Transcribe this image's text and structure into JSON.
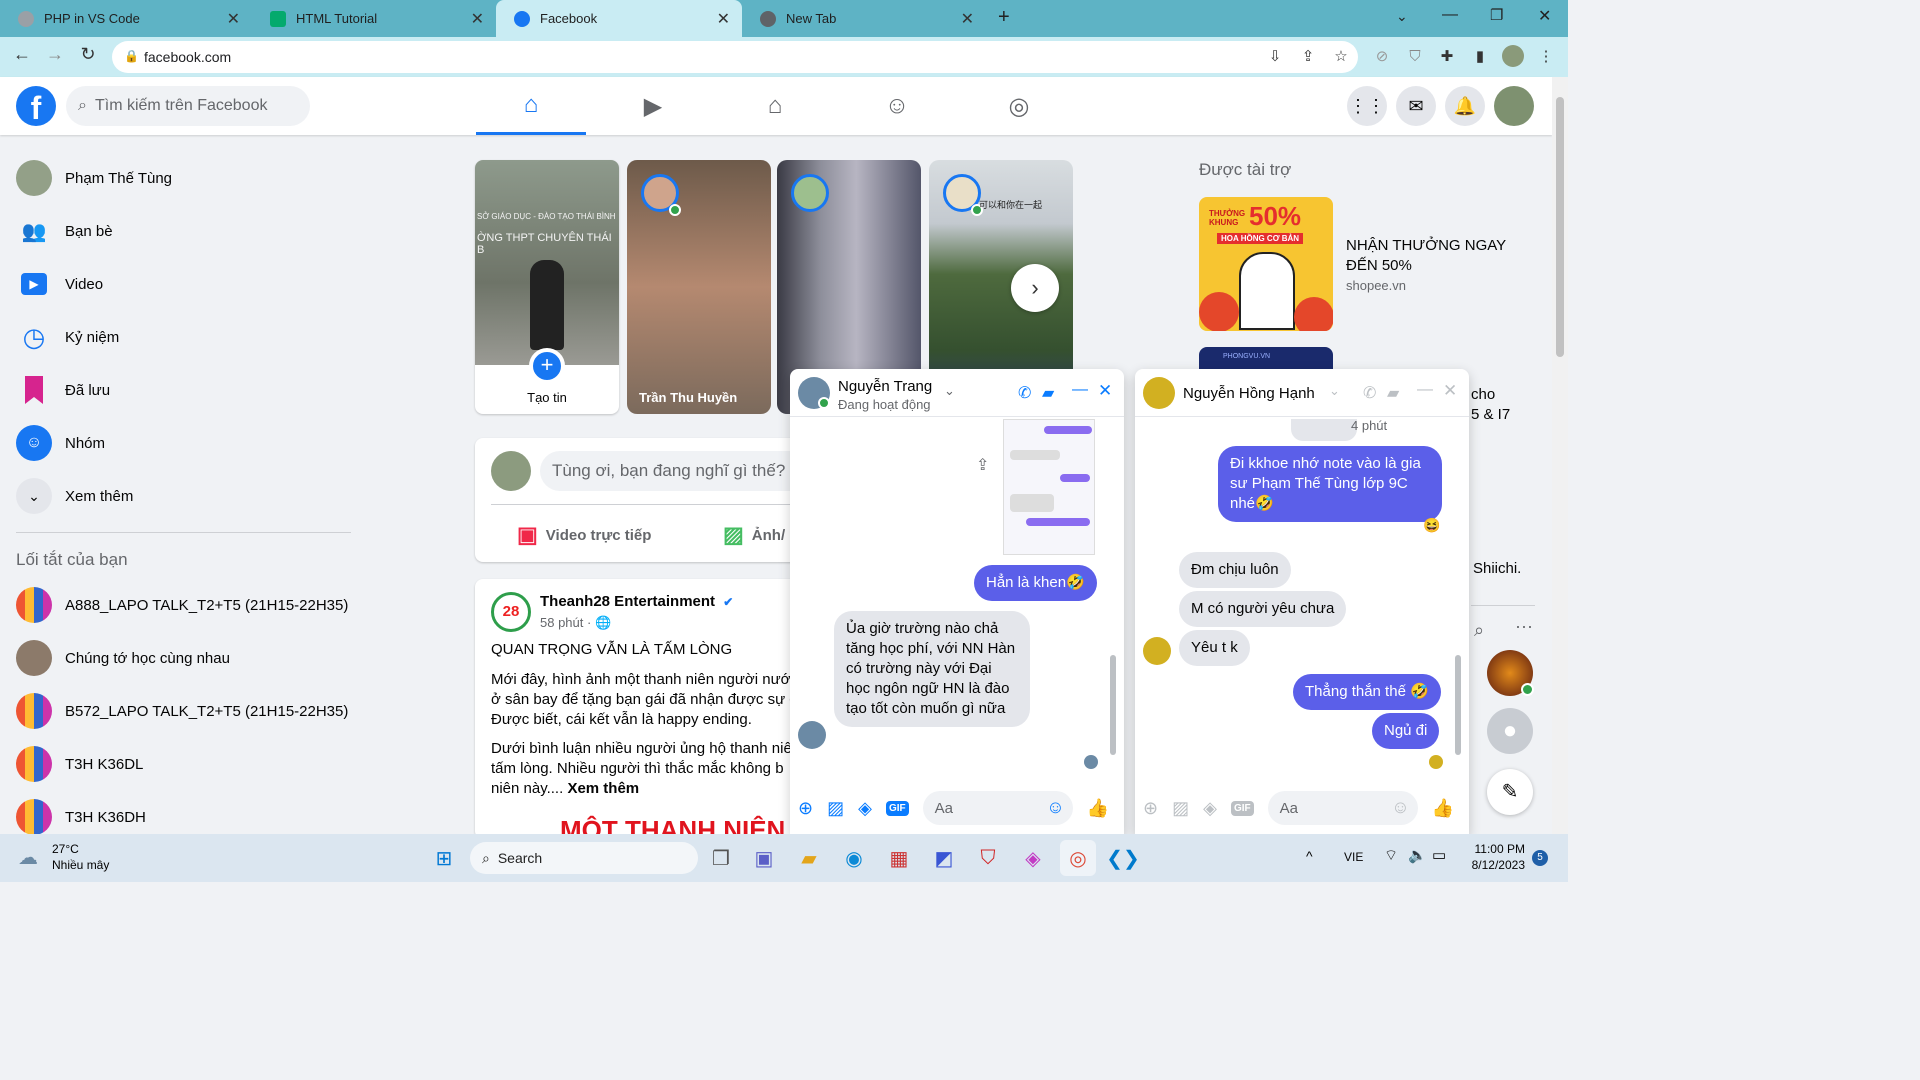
{
  "browser": {
    "tabs": [
      {
        "title": "PHP in VS Code"
      },
      {
        "title": "HTML Tutorial"
      },
      {
        "title": "Facebook"
      },
      {
        "title": "New Tab"
      }
    ],
    "url": "facebook.com"
  },
  "facebook": {
    "search_placeholder": "Tìm kiếm trên Facebook",
    "sidebar": {
      "items": [
        {
          "label": "Phạm Thế Tùng"
        },
        {
          "label": "Bạn bè"
        },
        {
          "label": "Video"
        },
        {
          "label": "Kỷ niệm"
        },
        {
          "label": "Đã lưu"
        },
        {
          "label": "Nhóm"
        },
        {
          "label": "Xem thêm"
        }
      ],
      "shortcuts_title": "Lối tắt của bạn",
      "shortcuts": [
        {
          "label": "A888_LAPO TALK_T2+T5 (21H15-22H35)"
        },
        {
          "label": "Chúng tớ học cùng nhau"
        },
        {
          "label": "B572_LAPO TALK_T2+T5 (21H15-22H35)"
        },
        {
          "label": "T3H K36DL"
        },
        {
          "label": "T3H K36DH"
        }
      ]
    },
    "stories": {
      "create_label": "Tạo tin",
      "items": [
        {
          "name": "Trần Thu Huyền"
        },
        {
          "name": ""
        },
        {
          "name": ""
        }
      ],
      "story3_caption": "可以和你在一起",
      "story0_sign": "SỞ GIÁO DỤC - ĐÀO TẠO THÁI BÌNH",
      "story0_sign2": "ỜNG THPT CHUYÊN THÁI B"
    },
    "composer": {
      "placeholder": "Tùng ơi, bạn đang nghĩ gì thế?",
      "live_label": "Video trực tiếp",
      "photo_label": "Ảnh/"
    },
    "post": {
      "author": "Theanh28 Entertainment",
      "time": "58 phút ·",
      "title": "QUAN TRỌNG VẪN LÀ TẤM LÒNG",
      "p1_l1": "Mới đây, hình ảnh một thanh niên người nước",
      "p1_l2": "ở sân bay để tặng bạn gái đã nhận được sự c",
      "p1_l3": "Được biết, cái kết vẫn là happy ending.",
      "p2_l1": "Dưới bình luận nhiều người ủng hộ thanh niê",
      "p2_l2": "tấm lòng. Nhiều người thì thắc mắc không b",
      "p2_l3": "niên này....",
      "see_more": "Xem thêm",
      "image_text": "MỘT THANH NIÊN"
    },
    "sponsored": {
      "title": "Được tài trợ",
      "ad1_text": "NHẬN THƯỞNG NGAY ĐẾN 50%",
      "ad1_domain": "shopee.vn",
      "ad1_img_big": "50%",
      "ad1_img_small": "THƯỞNG KHUNG",
      "ad1_img_banner": "HOA HỒNG CƠ BẢN",
      "ad2_img": "PHONGVU.VN",
      "ad2_partial1": "cho",
      "ad2_partial2": "5 & I7",
      "contact_partial": "Shiichi."
    },
    "chat1": {
      "name": "Nguyễn Trang",
      "status": "Đang hoạt động",
      "messages": [
        {
          "text": "Hẳn là khen🤣"
        },
        {
          "text": "Ủa giờ trường nào chả tăng học phí, với NN Hàn có trường này với Đại học ngôn ngữ HN là đào tạo tốt còn muốn gì nữa"
        }
      ],
      "input_placeholder": "Aa"
    },
    "chat2": {
      "name": "Nguyễn Hồng Hạnh",
      "time_label": "4 phút",
      "messages": [
        {
          "text": "Đi kkhoe nhớ note vào là gia sư Phạm Thế Tùng lớp 9C nhé🤣"
        },
        {
          "text": "Đm chịu luôn"
        },
        {
          "text": "M có người yêu chưa"
        },
        {
          "text": "Yêu t k"
        },
        {
          "text": "Thẳng thắn thế 🤣"
        },
        {
          "text": "Ngủ đi"
        }
      ],
      "reaction": "😆",
      "input_placeholder": "Aa"
    }
  },
  "taskbar": {
    "weather_temp": "27°C",
    "weather_desc": "Nhiều mây",
    "search_label": "Search",
    "lang": "VIE",
    "time": "11:00 PM",
    "date": "8/12/2023",
    "notif": "5"
  }
}
